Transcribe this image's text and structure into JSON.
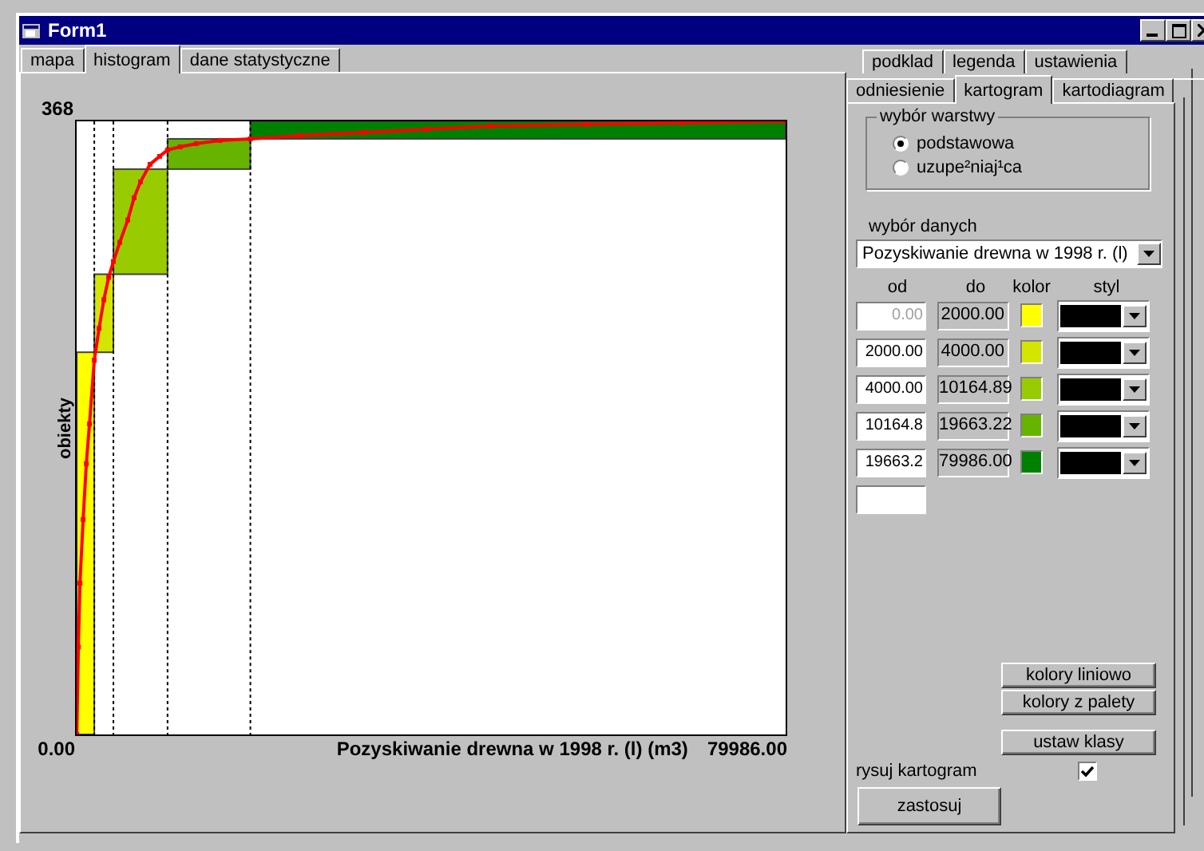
{
  "window": {
    "title": "Form1"
  },
  "left_tabs": [
    {
      "label": "mapa",
      "selected": false
    },
    {
      "label": "histogram",
      "selected": true
    },
    {
      "label": "dane statystyczne",
      "selected": false
    }
  ],
  "histogram": {
    "y_max": "368",
    "y_min": "0.00",
    "y_label": "obiekty",
    "x_label": "Pozyskiwanie drewna w 1998 r. (l) (m3)",
    "x_max": "79986.00"
  },
  "right_tabs_row1": [
    {
      "label": "podklad",
      "selected": false
    },
    {
      "label": "legenda",
      "selected": false
    },
    {
      "label": "ustawienia",
      "selected": false
    }
  ],
  "right_tabs_row2": [
    {
      "label": "odniesienie",
      "selected": false
    },
    {
      "label": "kartogram",
      "selected": true
    },
    {
      "label": "kartodiagram",
      "selected": false
    }
  ],
  "layer_group": {
    "title": "wybór warstwy",
    "options": [
      {
        "label": "podstawowa",
        "selected": true
      },
      {
        "label": "uzupe²niaj¹ca",
        "selected": false
      }
    ]
  },
  "data_select": {
    "label": "wybór danych",
    "value": "Pozyskiwanie drewna w 1998 r. (l)"
  },
  "class_columns": [
    "od",
    "do",
    "kolor",
    "styl"
  ],
  "classes": [
    {
      "od": "0.00",
      "od_disabled": true,
      "do": "2000.00",
      "color": "#ffff00"
    },
    {
      "od": "2000.00",
      "od_disabled": false,
      "do": "4000.00",
      "color": "#d4e600"
    },
    {
      "od": "4000.00",
      "od_disabled": false,
      "do": "10164.89",
      "color": "#99cc00"
    },
    {
      "od": "10164.8",
      "od_disabled": false,
      "do": "19663.22",
      "color": "#66b300"
    },
    {
      "od": "19663.2",
      "od_disabled": false,
      "do": "79986.00",
      "color": "#008000"
    }
  ],
  "color_buttons": [
    "kolory liniowo",
    "kolory z palety"
  ],
  "classes_button": "ustaw klasy",
  "draw_checkbox": {
    "label": "rysuj kartogram",
    "checked": true
  },
  "apply_button": "zastosuj"
}
